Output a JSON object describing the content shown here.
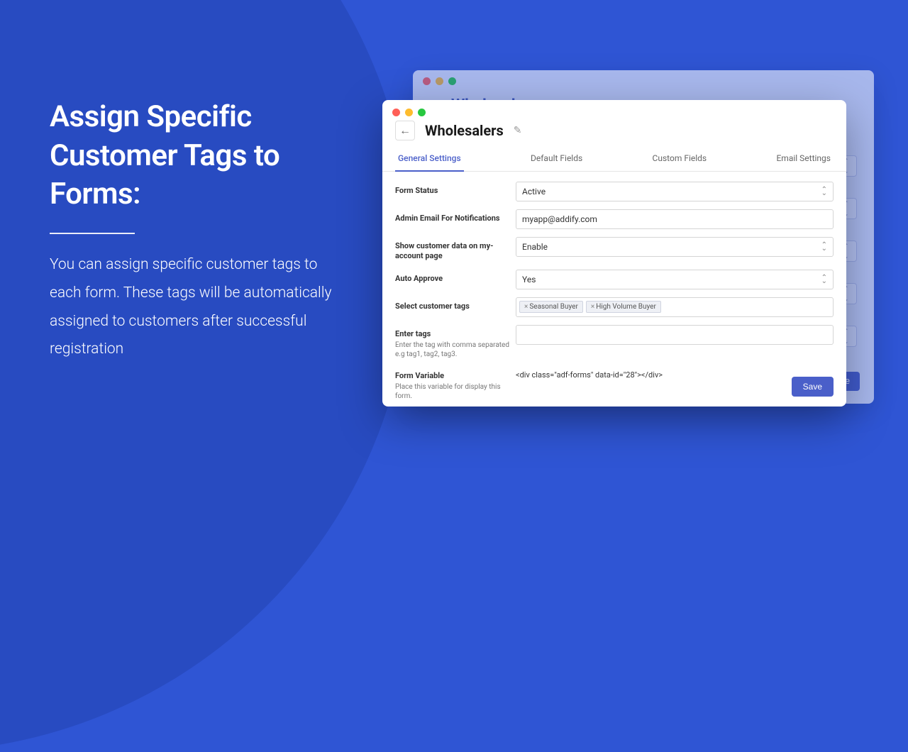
{
  "promo": {
    "title": "Assign Specific Customer Tags to Forms:",
    "desc": "You can assign specific customer tags to each form. These tags will be automatically assigned to customers after successful registration"
  },
  "backWindow": {
    "title": "Wholesalers",
    "save": "Save"
  },
  "window": {
    "title": "Wholesalers",
    "tabs": [
      "General Settings",
      "Default Fields",
      "Custom Fields",
      "Email Settings"
    ],
    "activeTab": 0,
    "fields": {
      "formStatus": {
        "label": "Form Status",
        "value": "Active"
      },
      "adminEmail": {
        "label": "Admin Email For Notifications",
        "value": "myapp@addify.com"
      },
      "showData": {
        "label": "Show customer data on my-account page",
        "value": "Enable"
      },
      "autoApprove": {
        "label": "Auto Approve",
        "value": "Yes"
      },
      "selectTags": {
        "label": "Select customer tags",
        "tags": [
          "Seasonal Buyer",
          "High Volume Buyer"
        ]
      },
      "enterTags": {
        "label": "Enter tags",
        "hint": "Enter the tag with comma separated e.g tag1, tag2, tag3.",
        "value": ""
      },
      "formVar": {
        "label": "Form Variable",
        "hint": "Place this variable for display this form.",
        "value": "<div class=\"adf-forms\" data-id=\"28\"></div>"
      }
    },
    "save": "Save"
  }
}
